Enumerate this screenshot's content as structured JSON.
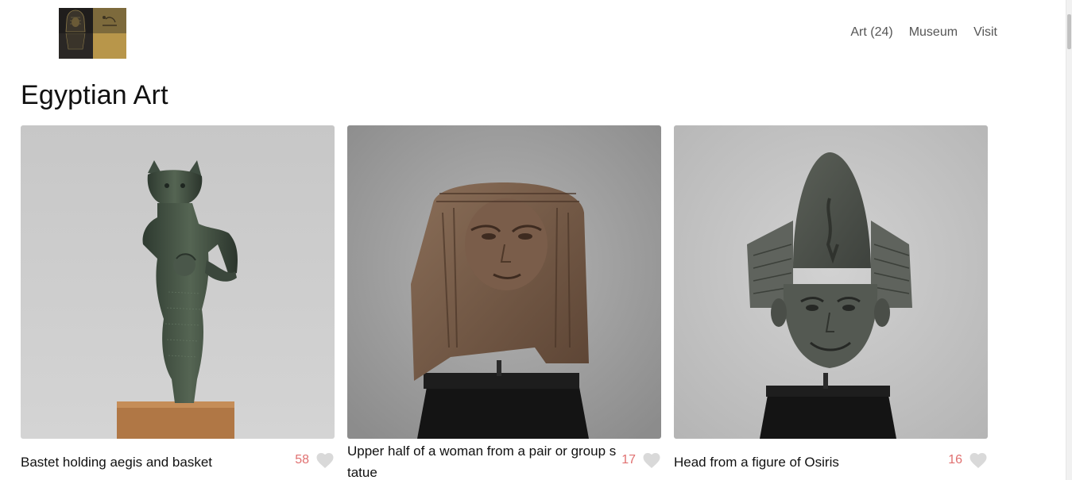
{
  "header": {
    "logo_icon": "museum-logo-icon",
    "nav": [
      {
        "label": "Art (24)"
      },
      {
        "label": "Museum"
      },
      {
        "label": "Visit"
      }
    ]
  },
  "page": {
    "title": "Egyptian Art"
  },
  "artworks": [
    {
      "title": "Bastet holding aegis and basket",
      "likes": "58",
      "icon": "heart-icon"
    },
    {
      "title": "Upper half of a woman from a pair or group statue",
      "likes": "17",
      "icon": "heart-icon"
    },
    {
      "title": "Head from a figure of Osiris",
      "likes": "16",
      "icon": "heart-icon"
    }
  ],
  "colors": {
    "like_count": "#e07070",
    "heart": "#d9d9d9",
    "nav_text": "#555555"
  }
}
